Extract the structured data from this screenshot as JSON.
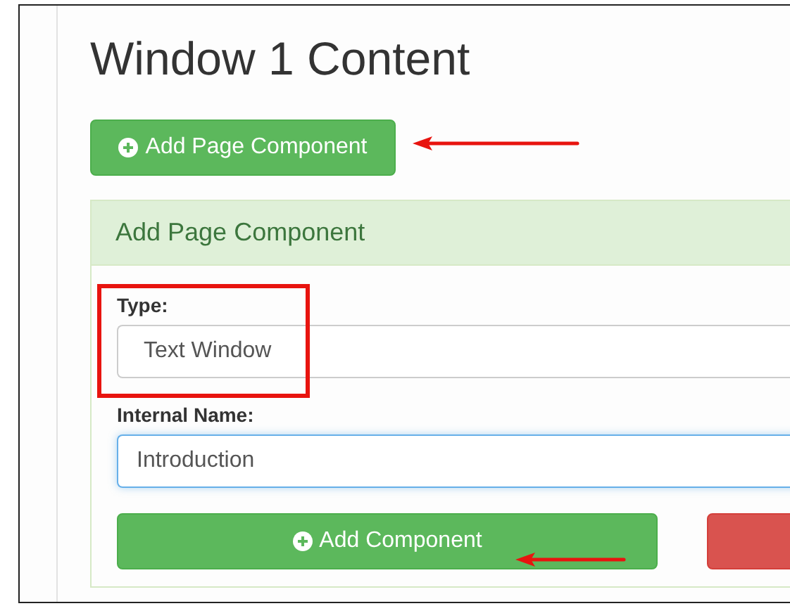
{
  "page": {
    "title": "Window 1 Content"
  },
  "add_button": {
    "label": "Add Page Component"
  },
  "panel": {
    "heading": "Add Page Component",
    "fields": [
      {
        "label": "Type:",
        "kind": "select",
        "value": "Text Window",
        "focused": false
      },
      {
        "label": "Internal Name:",
        "kind": "text",
        "value": "Introduction",
        "focused": true
      }
    ],
    "buttons": [
      {
        "label": "Add Component",
        "kind": "success"
      },
      {
        "kind": "danger"
      }
    ]
  },
  "annotations": [
    {
      "kind": "arrow"
    },
    {
      "kind": "box"
    },
    {
      "kind": "arrow"
    }
  ]
}
